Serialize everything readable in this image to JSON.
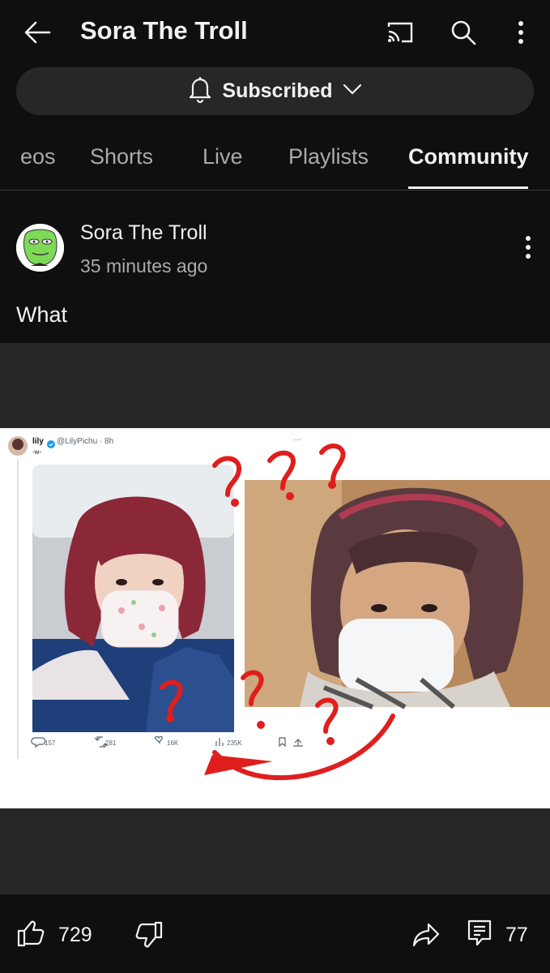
{
  "header": {
    "title": "Sora The Troll"
  },
  "subscribe": {
    "label": "Subscribed"
  },
  "tabs": [
    {
      "label": "eos"
    },
    {
      "label": "Shorts"
    },
    {
      "label": "Live"
    },
    {
      "label": "Playlists"
    },
    {
      "label": "Community",
      "active": true
    }
  ],
  "post": {
    "channel": "Sora The Troll",
    "time": "35 minutes ago",
    "text": "What"
  },
  "tweet": {
    "name": "lily",
    "handle": "@LilyPichu · 8h",
    "text": "-w-",
    "menu": "···",
    "stats": {
      "replies": "157",
      "retweets": "281",
      "likes": "16K",
      "views": "235K"
    },
    "annotation": "?"
  },
  "actions": {
    "likes": "729",
    "comments": "77"
  },
  "colors": {
    "background": "#0f0f0f",
    "surface": "#272727",
    "annotation": "#e01e1e",
    "verified": "#1d9bf0"
  }
}
